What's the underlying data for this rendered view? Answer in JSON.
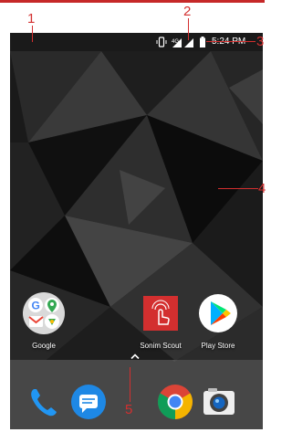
{
  "status_bar": {
    "time": "5:24 PM",
    "icons": [
      "vibrate-icon",
      "no-sim-icon",
      "signal-icon",
      "battery-icon"
    ]
  },
  "home_apps": [
    {
      "label": "Google",
      "icon": "google-folder-icon"
    },
    {
      "label": "Sonim Scout",
      "icon": "sonim-scout-icon"
    },
    {
      "label": "Play Store",
      "icon": "play-store-icon"
    }
  ],
  "dock_apps": [
    "phone-icon",
    "messages-icon",
    "chrome-icon",
    "camera-icon"
  ],
  "callouts": {
    "c1": "1",
    "c2": "2",
    "c3": "3",
    "c4": "4",
    "c5": "5"
  },
  "colors": {
    "callout": "#d32f2f",
    "sonim_red": "#d32f2f",
    "dock": "#6e6e6e"
  }
}
